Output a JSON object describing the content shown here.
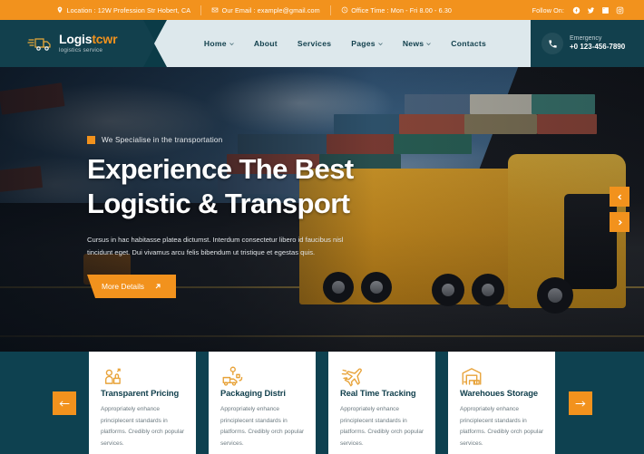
{
  "topbar": {
    "location": "Location : 12W Profession Str Hobert, CA",
    "email": "Our Email : example@gmail.com",
    "office_time": "Office Time : Mon - Fri 8.00 - 6.30",
    "follow_label": "Follow On:",
    "socials": [
      "facebook-icon",
      "twitter-icon",
      "linkedin-icon",
      "instagram-icon"
    ],
    "bg_color": "#f2921d"
  },
  "header": {
    "logo_name_primary": "Logis",
    "logo_name_accent": "tcwr",
    "logo_tagline": "logistics service",
    "nav": [
      {
        "label": "Home",
        "has_dropdown": true
      },
      {
        "label": "About",
        "has_dropdown": false
      },
      {
        "label": "Services",
        "has_dropdown": false
      },
      {
        "label": "Pages",
        "has_dropdown": true
      },
      {
        "label": "News",
        "has_dropdown": true
      },
      {
        "label": "Contacts",
        "has_dropdown": false
      }
    ],
    "emergency_label": "Emergency",
    "emergency_number": "+0 123-456-7890",
    "dark_color": "#12404d",
    "nav_bg_color": "#dde8ec"
  },
  "hero": {
    "badge": "We Specialise in the transportation",
    "heading_line1": "Experience The Best",
    "heading_line2": "Logistic & Transport",
    "paragraph": "Cursus in hac habitasse platea dictumst. Interdum consectetur libero id faucibus nisl tincidunt eget. Dui vivamus arcu felis bibendum ut tristique et egestas quis.",
    "button_label": "More Details",
    "prev_label": "‹",
    "next_label": "›",
    "accent_color": "#f2921d"
  },
  "cards": {
    "prev_arrow": "carousel-prev",
    "next_arrow": "carousel-next",
    "items": [
      {
        "icon": "transparent-pricing-icon",
        "title": "Transparent Pricing",
        "desc": "Appropriately enhance principlecent standards in platforms. Credibly orch popular services."
      },
      {
        "icon": "packaging-distribution-icon",
        "title": "Packaging Distri",
        "desc": "Appropriately enhance principlecent standards in platforms. Credibly orch popular services."
      },
      {
        "icon": "real-time-tracking-icon",
        "title": "Real Time Tracking",
        "desc": "Appropriately enhance principlecent standards in platforms. Credibly orch popular services."
      },
      {
        "icon": "warehouse-storage-icon",
        "title": "Warehoues Storage",
        "desc": "Appropriately enhance principlecent standards in platforms. Credibly orch popular services."
      }
    ],
    "band_color": "#0e4150"
  }
}
